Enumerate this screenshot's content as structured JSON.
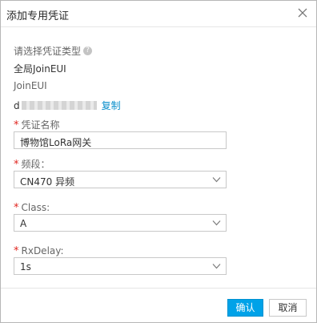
{
  "dialog": {
    "title": "添加专用凭证"
  },
  "credential_type": {
    "label": "请选择凭证类型",
    "help": "?",
    "value": "全局JoinEUI"
  },
  "joineui": {
    "label": "JoinEUI",
    "value_prefix": "d",
    "copy_label": "复制"
  },
  "name_field": {
    "label": "凭证名称",
    "value": "博物馆LoRa网关"
  },
  "band_field": {
    "label": "频段：",
    "value": "CN470 异频"
  },
  "class_field": {
    "label": "Class:",
    "value": "A"
  },
  "rxdelay_field": {
    "label": "RxDelay:",
    "value": "1s"
  },
  "required_mark": "*",
  "buttons": {
    "confirm": "确认",
    "cancel": "取消"
  },
  "icons": {
    "close": "close-icon",
    "help": "help-icon",
    "caret": "chevron-down-icon"
  },
  "colors": {
    "primary": "#00a2e8",
    "link": "#0a8fcc",
    "required": "#e0241e"
  }
}
